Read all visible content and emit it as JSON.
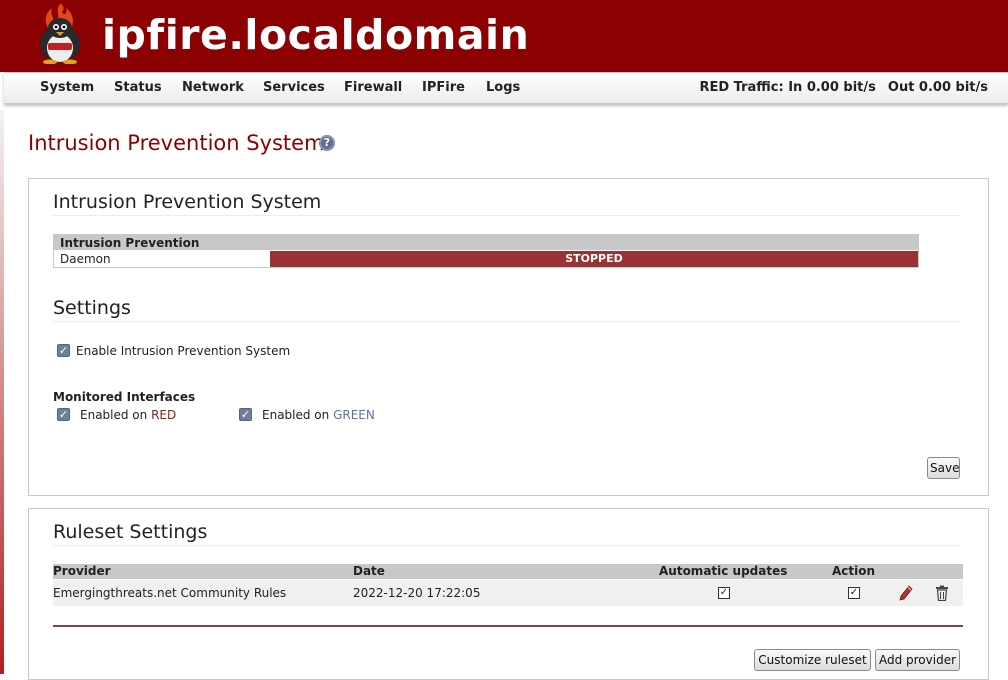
{
  "header": {
    "hostname": "ipfire.localdomain",
    "logo_icon": "ipfire-penguin-logo",
    "background_color": "#8b0000"
  },
  "menu": {
    "items": [
      "System",
      "Status",
      "Network",
      "Services",
      "Firewall",
      "IPFire",
      "Logs"
    ],
    "traffic": {
      "in_label": "RED Traffic: In 0.00 bit/s",
      "out_label": "Out 0.00 bit/s"
    }
  },
  "page": {
    "title": "Intrusion Prevention System",
    "help_icon": "question-circle-icon"
  },
  "ips_box": {
    "title": "Intrusion Prevention System",
    "status_header": "Intrusion Prevention",
    "daemon_label": "Daemon",
    "daemon_status": "STOPPED",
    "status_color": "#993333",
    "settings_title": "Settings",
    "enable_label": "Enable Intrusion Prevention System",
    "enable_checked": true,
    "monitored_title": "Monitored Interfaces",
    "interfaces": [
      {
        "prefix": "Enabled on ",
        "name": "RED",
        "checked": true,
        "color": "#8b2020"
      },
      {
        "prefix": "Enabled on ",
        "name": "GREEN",
        "checked": true,
        "color": "#5f7396"
      }
    ],
    "save_label": "Save"
  },
  "ruleset_box": {
    "title": "Ruleset Settings",
    "columns": [
      "Provider",
      "Date",
      "Automatic updates",
      "Action"
    ],
    "rows": [
      {
        "provider": "Emergingthreats.net Community Rules",
        "date": "2022-12-20 17:22:05",
        "automatic_updates": true,
        "action_enabled": true,
        "edit_icon": "pencil-icon",
        "delete_icon": "trash-icon"
      }
    ],
    "customize_label": "Customize ruleset",
    "add_provider_label": "Add provider"
  }
}
